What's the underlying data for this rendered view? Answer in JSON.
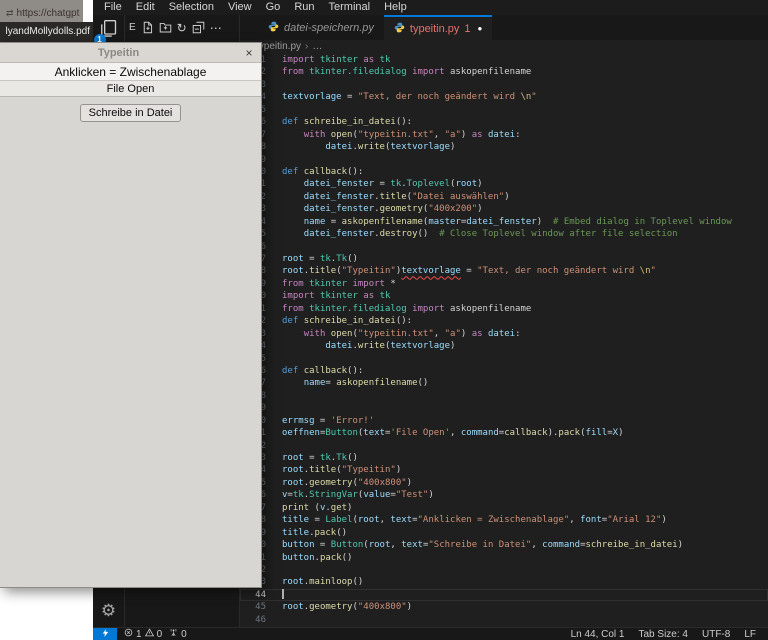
{
  "browser": {
    "url_text": "https://chatgpt",
    "pdf_tab_title": "lyandMollydolls.pdf"
  },
  "menubar": {
    "items": [
      "File",
      "Edit",
      "Selection",
      "View",
      "Go",
      "Run",
      "Terminal",
      "Help"
    ]
  },
  "activity_bar": {
    "explorer_badge": "1",
    "gear_glyph": "⚙"
  },
  "explorer_header": {
    "prefix": "E",
    "refresh_glyph": "↻",
    "more_glyph": "⋯"
  },
  "tabs": {
    "preview": {
      "label": "datei-speichern.py"
    },
    "active": {
      "label": "typeitin.py",
      "problem_count": "1",
      "modified_dot": "●"
    }
  },
  "breadcrumb": {
    "file": "typeitin.py",
    "separator": "›",
    "more": "…"
  },
  "tk_window": {
    "title": "Typeitin",
    "close_glyph": "×",
    "label": "Anklicken = Zwischenablage",
    "file_open_button": "File Open",
    "write_button": "Schreibe in Datei"
  },
  "status_bar": {
    "error_count": "1",
    "warning_count": "0",
    "ports_count": "0",
    "line_col": "Ln 44, Col 1",
    "tab_size": "Tab Size: 4",
    "encoding": "UTF-8",
    "eol": "LF"
  },
  "colors": {
    "accent": "#0078d4",
    "error": "#f14c4c",
    "tab_error_label": "#e5726a",
    "keyword": "#C586C0",
    "def_keyword": "#569CD6",
    "function": "#DCDCAA",
    "class": "#4EC9B0",
    "variable": "#9CDCFE",
    "string": "#CE9178",
    "escape": "#D7BA7D",
    "comment": "#6A9955",
    "plain": "#D4D4D4"
  },
  "editor": {
    "current_line": 44,
    "lines": [
      {
        "n": 1,
        "t": [
          [
            "k",
            "import"
          ],
          [
            "t",
            " "
          ],
          [
            "c",
            "tkinter"
          ],
          [
            "t",
            " "
          ],
          [
            "k",
            "as"
          ],
          [
            "t",
            " "
          ],
          [
            "c",
            "tk"
          ]
        ]
      },
      {
        "n": 2,
        "t": [
          [
            "k",
            "from"
          ],
          [
            "t",
            " "
          ],
          [
            "c",
            "tkinter.filedialog"
          ],
          [
            "t",
            " "
          ],
          [
            "k",
            "import"
          ],
          [
            "t",
            " "
          ],
          [
            "t",
            "askopenfilename"
          ]
        ]
      },
      {
        "n": 3,
        "t": []
      },
      {
        "n": 4,
        "t": [
          [
            "v",
            "textvorlage"
          ],
          [
            "t",
            " = "
          ],
          [
            "s",
            "\"Text, der noch geändert wird "
          ],
          [
            "e",
            "\\n"
          ],
          [
            "s",
            "\""
          ]
        ]
      },
      {
        "n": 5,
        "t": []
      },
      {
        "n": 6,
        "t": [
          [
            "d",
            "def"
          ],
          [
            "t",
            " "
          ],
          [
            "f",
            "schreibe_in_datei"
          ],
          [
            "t",
            "():"
          ]
        ]
      },
      {
        "n": 7,
        "t": [
          [
            "t",
            "    "
          ],
          [
            "k",
            "with"
          ],
          [
            "t",
            " "
          ],
          [
            "f",
            "open"
          ],
          [
            "t",
            "("
          ],
          [
            "s",
            "\"typeitin.txt\""
          ],
          [
            "t",
            ", "
          ],
          [
            "s",
            "\"a\""
          ],
          [
            "t",
            ") "
          ],
          [
            "k",
            "as"
          ],
          [
            "t",
            " "
          ],
          [
            "v",
            "datei"
          ],
          [
            "t",
            ":"
          ]
        ]
      },
      {
        "n": 8,
        "t": [
          [
            "t",
            "        "
          ],
          [
            "v",
            "datei"
          ],
          [
            "t",
            "."
          ],
          [
            "f",
            "write"
          ],
          [
            "t",
            "("
          ],
          [
            "v",
            "textvorlage"
          ],
          [
            "t",
            ")"
          ]
        ]
      },
      {
        "n": 9,
        "t": []
      },
      {
        "n": 10,
        "t": [
          [
            "d",
            "def"
          ],
          [
            "t",
            " "
          ],
          [
            "f",
            "callback"
          ],
          [
            "t",
            "():"
          ]
        ]
      },
      {
        "n": 11,
        "t": [
          [
            "t",
            "    "
          ],
          [
            "v",
            "datei_fenster"
          ],
          [
            "t",
            " = "
          ],
          [
            "c",
            "tk"
          ],
          [
            "t",
            "."
          ],
          [
            "c",
            "Toplevel"
          ],
          [
            "t",
            "("
          ],
          [
            "v",
            "root"
          ],
          [
            "t",
            ")"
          ]
        ]
      },
      {
        "n": 12,
        "t": [
          [
            "t",
            "    "
          ],
          [
            "v",
            "datei_fenster"
          ],
          [
            "t",
            "."
          ],
          [
            "f",
            "title"
          ],
          [
            "t",
            "("
          ],
          [
            "s",
            "\"Datei auswählen\""
          ],
          [
            "t",
            ")"
          ]
        ]
      },
      {
        "n": 13,
        "t": [
          [
            "t",
            "    "
          ],
          [
            "v",
            "datei_fenster"
          ],
          [
            "t",
            "."
          ],
          [
            "f",
            "geometry"
          ],
          [
            "t",
            "("
          ],
          [
            "s",
            "\"400x200\""
          ],
          [
            "t",
            ")"
          ]
        ]
      },
      {
        "n": 14,
        "t": [
          [
            "t",
            "    "
          ],
          [
            "v",
            "name"
          ],
          [
            "t",
            " = "
          ],
          [
            "f",
            "askopenfilename"
          ],
          [
            "t",
            "("
          ],
          [
            "v",
            "master"
          ],
          [
            "t",
            "="
          ],
          [
            "v",
            "datei_fenster"
          ],
          [
            "t",
            ")  "
          ],
          [
            "m",
            "# Embed dialog in Toplevel window"
          ]
        ]
      },
      {
        "n": 15,
        "t": [
          [
            "t",
            "    "
          ],
          [
            "v",
            "datei_fenster"
          ],
          [
            "t",
            "."
          ],
          [
            "f",
            "destroy"
          ],
          [
            "t",
            "()  "
          ],
          [
            "m",
            "# Close Toplevel window after file selection"
          ]
        ]
      },
      {
        "n": 16,
        "t": []
      },
      {
        "n": 17,
        "t": [
          [
            "v",
            "root"
          ],
          [
            "t",
            " = "
          ],
          [
            "c",
            "tk"
          ],
          [
            "t",
            "."
          ],
          [
            "c",
            "Tk"
          ],
          [
            "t",
            "()"
          ]
        ]
      },
      {
        "n": 18,
        "t": [
          [
            "v",
            "root"
          ],
          [
            "t",
            "."
          ],
          [
            "f",
            "title"
          ],
          [
            "t",
            "("
          ],
          [
            "s",
            "\"Typeitin\""
          ],
          [
            "t",
            ")"
          ],
          [
            "verr",
            "textvorlage"
          ],
          [
            "t",
            " = "
          ],
          [
            "s",
            "\"Text, der noch geändert wird "
          ],
          [
            "e",
            "\\n"
          ],
          [
            "s",
            "\""
          ]
        ]
      },
      {
        "n": 19,
        "t": [
          [
            "k",
            "from"
          ],
          [
            "t",
            " "
          ],
          [
            "c",
            "tkinter"
          ],
          [
            "t",
            " "
          ],
          [
            "k",
            "import"
          ],
          [
            "t",
            " *"
          ]
        ]
      },
      {
        "n": 20,
        "t": [
          [
            "k",
            "import"
          ],
          [
            "t",
            " "
          ],
          [
            "c",
            "tkinter"
          ],
          [
            "t",
            " "
          ],
          [
            "k",
            "as"
          ],
          [
            "t",
            " "
          ],
          [
            "c",
            "tk"
          ]
        ]
      },
      {
        "n": 21,
        "t": [
          [
            "k",
            "from"
          ],
          [
            "t",
            " "
          ],
          [
            "c",
            "tkinter.filedialog"
          ],
          [
            "t",
            " "
          ],
          [
            "k",
            "import"
          ],
          [
            "t",
            " "
          ],
          [
            "t",
            "askopenfilename"
          ]
        ]
      },
      {
        "n": 22,
        "t": [
          [
            "d",
            "def"
          ],
          [
            "t",
            " "
          ],
          [
            "f",
            "schreibe_in_datei"
          ],
          [
            "t",
            "():"
          ]
        ]
      },
      {
        "n": 23,
        "t": [
          [
            "t",
            "    "
          ],
          [
            "k",
            "with"
          ],
          [
            "t",
            " "
          ],
          [
            "f",
            "open"
          ],
          [
            "t",
            "("
          ],
          [
            "s",
            "\"typeitin.txt\""
          ],
          [
            "t",
            ", "
          ],
          [
            "s",
            "\"a\""
          ],
          [
            "t",
            ") "
          ],
          [
            "k",
            "as"
          ],
          [
            "t",
            " "
          ],
          [
            "v",
            "datei"
          ],
          [
            "t",
            ":"
          ]
        ]
      },
      {
        "n": 24,
        "t": [
          [
            "t",
            "        "
          ],
          [
            "v",
            "datei"
          ],
          [
            "t",
            "."
          ],
          [
            "f",
            "write"
          ],
          [
            "t",
            "("
          ],
          [
            "v",
            "textvorlage"
          ],
          [
            "t",
            ")"
          ]
        ]
      },
      {
        "n": 25,
        "t": []
      },
      {
        "n": 26,
        "t": [
          [
            "d",
            "def"
          ],
          [
            "t",
            " "
          ],
          [
            "f",
            "callback"
          ],
          [
            "t",
            "():"
          ]
        ]
      },
      {
        "n": 27,
        "t": [
          [
            "t",
            "    "
          ],
          [
            "v",
            "name"
          ],
          [
            "t",
            "= "
          ],
          [
            "f",
            "askopenfilename"
          ],
          [
            "t",
            "()"
          ]
        ]
      },
      {
        "n": 28,
        "t": []
      },
      {
        "n": 29,
        "t": []
      },
      {
        "n": 30,
        "t": [
          [
            "v",
            "errmsg"
          ],
          [
            "t",
            " = "
          ],
          [
            "s",
            "'Error!'"
          ]
        ]
      },
      {
        "n": 31,
        "t": [
          [
            "v",
            "oeffnen"
          ],
          [
            "t",
            "="
          ],
          [
            "c",
            "Button"
          ],
          [
            "t",
            "("
          ],
          [
            "v",
            "text"
          ],
          [
            "t",
            "="
          ],
          [
            "s",
            "'File Open'"
          ],
          [
            "t",
            ", "
          ],
          [
            "v",
            "command"
          ],
          [
            "t",
            "="
          ],
          [
            "f",
            "callback"
          ],
          [
            "t",
            ")."
          ],
          [
            "f",
            "pack"
          ],
          [
            "t",
            "("
          ],
          [
            "v",
            "fill"
          ],
          [
            "t",
            "="
          ],
          [
            "v",
            "X"
          ],
          [
            "t",
            ")"
          ]
        ]
      },
      {
        "n": 32,
        "t": []
      },
      {
        "n": 33,
        "t": [
          [
            "v",
            "root"
          ],
          [
            "t",
            " = "
          ],
          [
            "c",
            "tk"
          ],
          [
            "t",
            "."
          ],
          [
            "c",
            "Tk"
          ],
          [
            "t",
            "()"
          ]
        ]
      },
      {
        "n": 34,
        "t": [
          [
            "v",
            "root"
          ],
          [
            "t",
            "."
          ],
          [
            "f",
            "title"
          ],
          [
            "t",
            "("
          ],
          [
            "s",
            "\"Typeitin\""
          ],
          [
            "t",
            ")"
          ]
        ]
      },
      {
        "n": 35,
        "t": [
          [
            "v",
            "root"
          ],
          [
            "t",
            "."
          ],
          [
            "f",
            "geometry"
          ],
          [
            "t",
            "("
          ],
          [
            "s",
            "\"400x800\""
          ],
          [
            "t",
            ")"
          ]
        ]
      },
      {
        "n": 36,
        "t": [
          [
            "v",
            "v"
          ],
          [
            "t",
            "="
          ],
          [
            "c",
            "tk"
          ],
          [
            "t",
            "."
          ],
          [
            "c",
            "StringVar"
          ],
          [
            "t",
            "("
          ],
          [
            "v",
            "value"
          ],
          [
            "t",
            "="
          ],
          [
            "s",
            "\"Test\""
          ],
          [
            "t",
            ")"
          ]
        ]
      },
      {
        "n": 37,
        "t": [
          [
            "f",
            "print"
          ],
          [
            "t",
            " ("
          ],
          [
            "v",
            "v"
          ],
          [
            "t",
            "."
          ],
          [
            "f",
            "get"
          ],
          [
            "t",
            ")"
          ]
        ]
      },
      {
        "n": 38,
        "t": [
          [
            "v",
            "title"
          ],
          [
            "t",
            " = "
          ],
          [
            "c",
            "Label"
          ],
          [
            "t",
            "("
          ],
          [
            "v",
            "root"
          ],
          [
            "t",
            ", "
          ],
          [
            "v",
            "text"
          ],
          [
            "t",
            "="
          ],
          [
            "s",
            "\"Anklicken = Zwischenablage\""
          ],
          [
            "t",
            ", "
          ],
          [
            "v",
            "font"
          ],
          [
            "t",
            "="
          ],
          [
            "s",
            "\"Arial 12\""
          ],
          [
            "t",
            ")"
          ]
        ]
      },
      {
        "n": 39,
        "t": [
          [
            "v",
            "title"
          ],
          [
            "t",
            "."
          ],
          [
            "f",
            "pack"
          ],
          [
            "t",
            "()"
          ]
        ]
      },
      {
        "n": 40,
        "t": [
          [
            "v",
            "button"
          ],
          [
            "t",
            " = "
          ],
          [
            "c",
            "Button"
          ],
          [
            "t",
            "("
          ],
          [
            "v",
            "root"
          ],
          [
            "t",
            ", "
          ],
          [
            "v",
            "text"
          ],
          [
            "t",
            "="
          ],
          [
            "s",
            "\"Schreibe in Datei\""
          ],
          [
            "t",
            ", "
          ],
          [
            "v",
            "command"
          ],
          [
            "t",
            "="
          ],
          [
            "f",
            "schreibe_in_datei"
          ],
          [
            "t",
            ")"
          ]
        ]
      },
      {
        "n": 41,
        "t": [
          [
            "v",
            "button"
          ],
          [
            "t",
            "."
          ],
          [
            "f",
            "pack"
          ],
          [
            "t",
            "()"
          ]
        ]
      },
      {
        "n": 42,
        "t": []
      },
      {
        "n": 43,
        "t": [
          [
            "v",
            "root"
          ],
          [
            "t",
            "."
          ],
          [
            "f",
            "mainloop"
          ],
          [
            "t",
            "()"
          ]
        ]
      },
      {
        "n": 44,
        "t": []
      },
      {
        "n": 45,
        "t": [
          [
            "v",
            "root"
          ],
          [
            "t",
            "."
          ],
          [
            "f",
            "geometry"
          ],
          [
            "t",
            "("
          ],
          [
            "s",
            "\"400x800\""
          ],
          [
            "t",
            ")"
          ]
        ]
      },
      {
        "n": 46,
        "t": []
      }
    ]
  }
}
